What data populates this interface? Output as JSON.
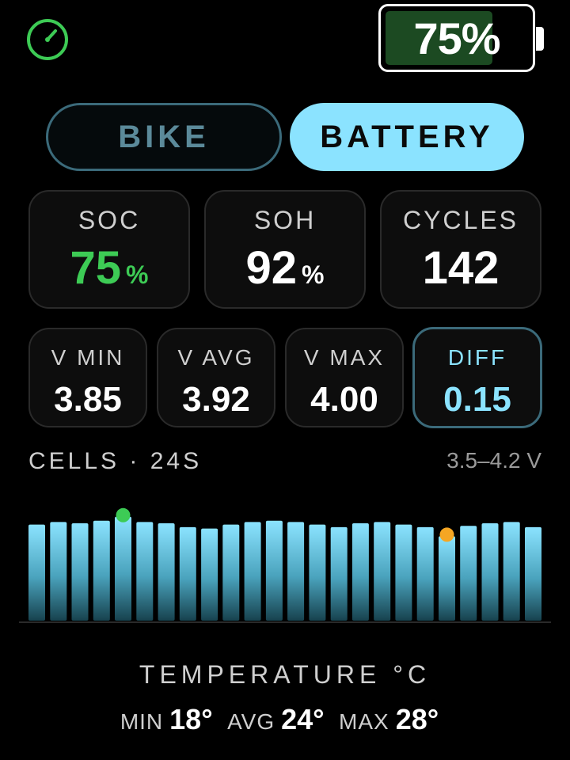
{
  "header": {
    "gauge_icon": "speedometer-icon",
    "battery_percent_label": "75%",
    "battery_level": 0.75,
    "battery_fill_color": "#1c4a22"
  },
  "tabs": [
    {
      "label": "BIKE",
      "active": false
    },
    {
      "label": "BATTERY",
      "active": true
    }
  ],
  "stats": {
    "soc": {
      "label": "SOC",
      "value": "75",
      "unit": "%"
    },
    "soh": {
      "label": "SOH",
      "value": "92",
      "unit": "%"
    },
    "cycles": {
      "label": "CYCLES",
      "value": "142"
    }
  },
  "voltages": {
    "vmin": {
      "label": "V MIN",
      "value": "3.85"
    },
    "vavg": {
      "label": "V AVG",
      "value": "3.92"
    },
    "vmax": {
      "label": "V MAX",
      "value": "4.00"
    },
    "diff": {
      "label": "DIFF",
      "value": "0.15"
    }
  },
  "cells": {
    "title": "CELLS · 24S",
    "range_label": "3.5–4.2 V",
    "min_v": 3.5,
    "max_v": 4.2,
    "voltages": [
      3.94,
      3.96,
      3.95,
      3.97,
      4.0,
      3.96,
      3.95,
      3.92,
      3.91,
      3.94,
      3.96,
      3.97,
      3.96,
      3.94,
      3.92,
      3.95,
      3.96,
      3.94,
      3.92,
      3.85,
      3.93,
      3.95,
      3.96,
      3.92
    ],
    "max_cell_index": 4,
    "min_cell_index": 19,
    "max_marker_color": "#3dcb55",
    "min_marker_color": "#f5a623"
  },
  "temperature": {
    "title": "TEMPERATURE °C",
    "min_label": "MIN",
    "min_value": "18°",
    "avg_label": "AVG",
    "avg_value": "24°",
    "max_label": "MAX",
    "max_value": "28°"
  }
}
